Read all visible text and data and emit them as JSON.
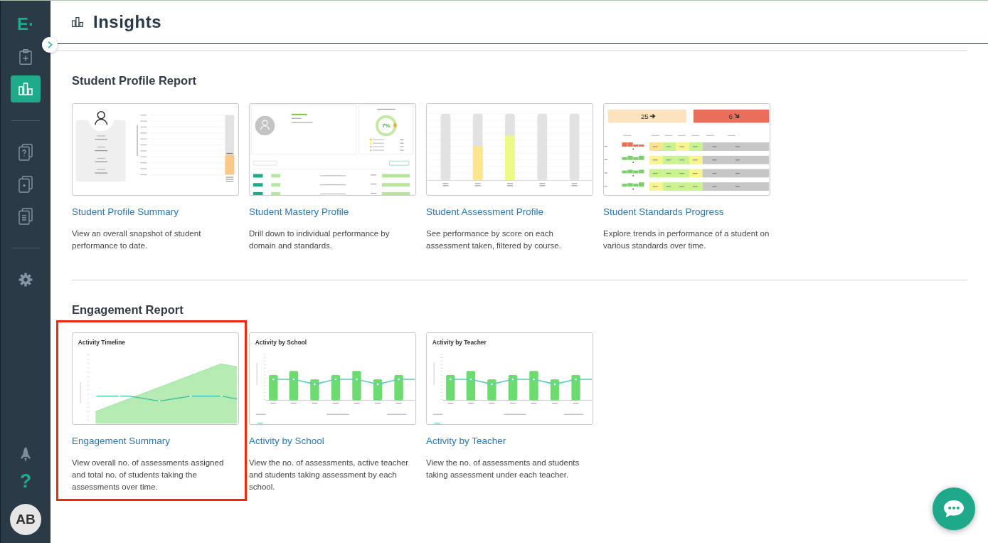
{
  "sidebar": {
    "logo": "E·",
    "nav_groups": [
      {
        "items": [
          {
            "kind": "clipboard-add",
            "selected": false
          },
          {
            "kind": "chart",
            "selected": true
          }
        ]
      },
      {
        "items": [
          {
            "kind": "doc-question",
            "selected": false
          },
          {
            "kind": "doc-dot",
            "selected": false
          },
          {
            "kind": "doc-lines",
            "selected": false
          }
        ]
      },
      {
        "items": [
          {
            "kind": "gear",
            "selected": false
          }
        ]
      }
    ],
    "bottom_items": [
      {
        "kind": "rocket"
      },
      {
        "kind": "help",
        "label": "?"
      }
    ],
    "avatar": {
      "initials": "AB"
    }
  },
  "header": {
    "title": "Insights"
  },
  "sections": [
    {
      "title": "Student Profile Report",
      "cards": [
        {
          "title": "Student Profile Summary",
          "description": "View an overall snapshot of student performance to date.",
          "highlighted": false,
          "preview": {
            "kind": "profile"
          }
        },
        {
          "title": "Student Mastery Profile",
          "description": "Drill down to individual performance by domain and standards.",
          "highlighted": false,
          "preview": {
            "kind": "mastery",
            "percent": "7%"
          }
        },
        {
          "title": "Student Assessment Profile",
          "description": "See performance by score on each assessment taken, filtered by course.",
          "highlighted": false,
          "preview": {
            "kind": "assessment-bars"
          }
        },
        {
          "title": "Student Standards Progress",
          "description": "Explore trends in performance of a student on various standards over time.",
          "highlighted": false,
          "preview": {
            "kind": "standards",
            "counts": [
              "25",
              "6"
            ]
          }
        }
      ]
    },
    {
      "title": "Engagement Report",
      "cards": [
        {
          "title": "Engagement Summary",
          "description": "View overall no. of assessments assigned and total no. of students taking the assessments over time.",
          "highlighted": true,
          "preview": {
            "kind": "timeline",
            "title": "Activity Timeline"
          }
        },
        {
          "title": "Activity by School",
          "description": "View the no. of assessments, active teacher and students taking assessment by each school.",
          "highlighted": false,
          "preview": {
            "kind": "activity-bars",
            "title": "Activity by School"
          }
        },
        {
          "title": "Activity by Teacher",
          "description": "View the no. of assessments and students taking assessment under each teacher.",
          "highlighted": false,
          "preview": {
            "kind": "activity-bars",
            "title": "Activity by Teacher"
          }
        }
      ]
    }
  ]
}
